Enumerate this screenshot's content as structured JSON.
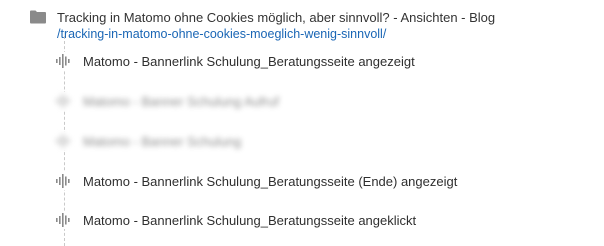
{
  "page": {
    "title": "Tracking in Matomo ohne Cookies möglich, aber sinnvoll? - Ansichten - Blog",
    "url": "/tracking-in-matomo-ohne-cookies-moeglich-wenig-sinnvoll/",
    "icon": "folder-icon"
  },
  "events": [
    {
      "label": "Matomo - Bannerlink Schulung_Beratungsseite angezeigt",
      "icon": "event-icon",
      "obscured": false
    },
    {
      "label": "Matomo - Banner Schulung Aufruf",
      "icon": "event-icon",
      "obscured": true
    },
    {
      "label": "Matomo - Banner Schulung",
      "icon": "event-icon",
      "obscured": true
    },
    {
      "label": "Matomo - Bannerlink Schulung_Beratungsseite (Ende) angezeigt",
      "icon": "event-icon",
      "obscured": false
    },
    {
      "label": "Matomo - Bannerlink Schulung_Beratungsseite angeklickt",
      "icon": "event-icon",
      "obscured": false
    }
  ],
  "colors": {
    "icon": "#8a8a8a",
    "link": "#1a66b5",
    "tree_line": "#c9c9c9"
  }
}
